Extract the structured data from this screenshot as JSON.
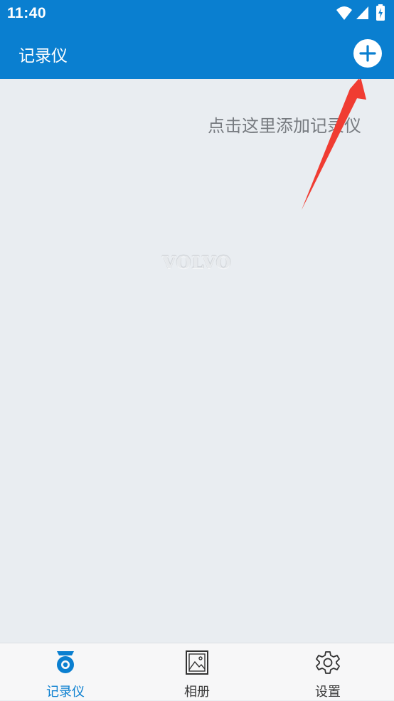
{
  "status_bar": {
    "time": "11:40",
    "icons": [
      "wifi-icon",
      "signal-icon",
      "battery-charging-icon"
    ]
  },
  "app_bar": {
    "title": "记录仪",
    "add_icon": "plus-icon"
  },
  "content": {
    "hint": "点击这里添加记录仪",
    "watermark": "VOLVO",
    "arrow_color": "#f03c32"
  },
  "bottom_nav": {
    "items": [
      {
        "label": "记录仪",
        "icon": "dashcam-icon",
        "active": true
      },
      {
        "label": "相册",
        "icon": "photo-album-icon",
        "active": false
      },
      {
        "label": "设置",
        "icon": "settings-gear-icon",
        "active": false
      }
    ]
  },
  "colors": {
    "primary": "#0a7fd0",
    "background": "#e9edf1",
    "nav_background": "#f7f7f8",
    "hint_text": "#777b80",
    "arrow": "#f03c32"
  }
}
